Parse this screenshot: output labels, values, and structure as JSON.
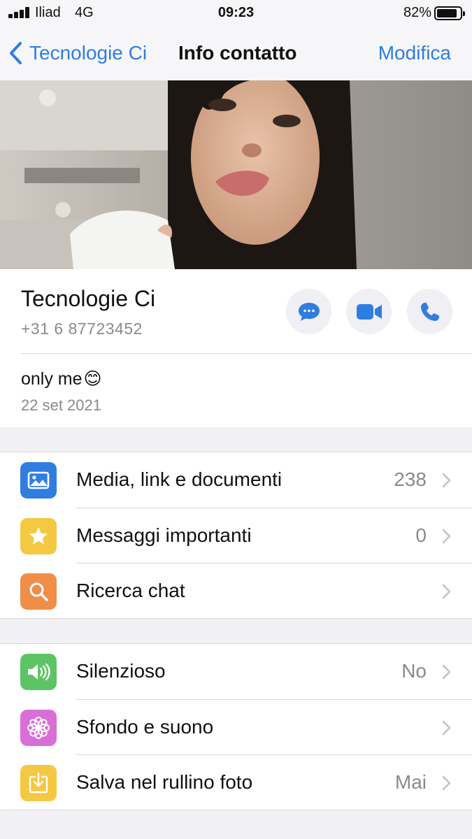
{
  "status_bar": {
    "carrier": "Iliad",
    "network": "4G",
    "time": "09:23",
    "battery": "82%"
  },
  "nav": {
    "back_label": "Tecnologie Ci",
    "title": "Info contatto",
    "edit_label": "Modifica"
  },
  "contact": {
    "name": "Tecnologie Ci",
    "phone": "+31 6 87723452",
    "about": "only me",
    "about_emoji": "😊",
    "about_date": "22 set 2021"
  },
  "actions": [
    {
      "icon": "message-icon"
    },
    {
      "icon": "video-call-icon"
    },
    {
      "icon": "phone-icon"
    }
  ],
  "group1": [
    {
      "icon": "photo-icon",
      "icon_color": "#2f7de1",
      "label": "Media, link e documenti",
      "value": "238"
    },
    {
      "icon": "star-icon",
      "icon_color": "#f5c842",
      "label": "Messaggi importanti",
      "value": "0"
    },
    {
      "icon": "search-icon",
      "icon_color": "#f08d49",
      "label": "Ricerca chat",
      "value": ""
    }
  ],
  "group2": [
    {
      "icon": "speaker-icon",
      "icon_color": "#5cc464",
      "label": "Silenzioso",
      "value": "No"
    },
    {
      "icon": "flower-icon",
      "icon_color": "#d96fd6",
      "label": "Sfondo e suono",
      "value": ""
    },
    {
      "icon": "save-icon",
      "icon_color": "#f5c842",
      "label": "Salva nel rullino foto",
      "value": "Mai"
    }
  ],
  "colors": {
    "accent": "#2f7de1",
    "secondary_text": "#8a8a8e",
    "background": "#f1f1f5"
  }
}
